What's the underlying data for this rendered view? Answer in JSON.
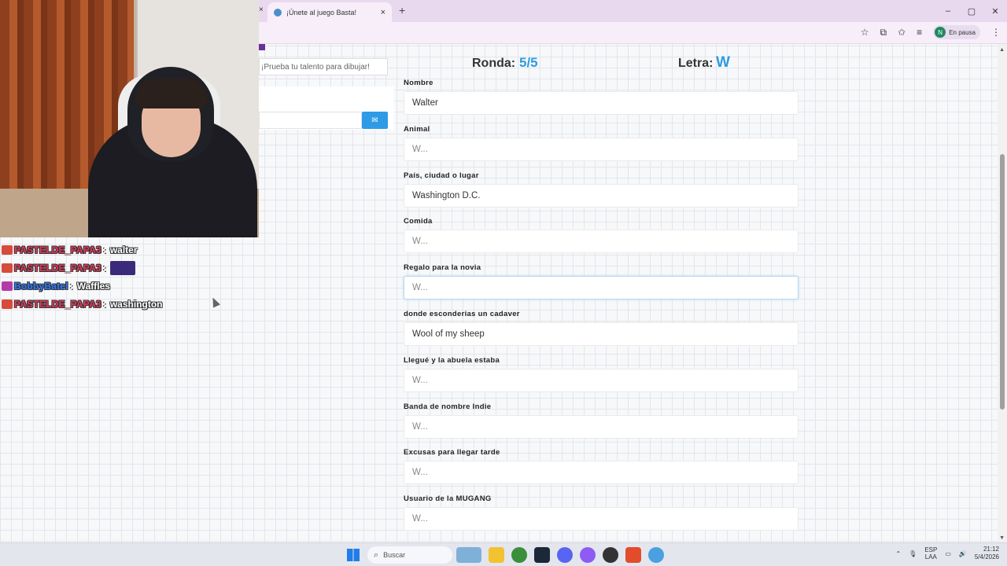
{
  "browser": {
    "tab_title": "¡Únete al juego Basta!",
    "tab_close": "×",
    "new_tab": "+",
    "window_controls": [
      "–",
      "▢",
      "✕"
    ],
    "profile_initial": "N",
    "profile_status": "En pausa"
  },
  "left_panel": {
    "draw_placeholder": "¡Prueba tu talento para dibujar!"
  },
  "stream_chat": [
    {
      "user": "PASTELDE_PAPA3",
      "message": "walter",
      "emote": false
    },
    {
      "user": "PASTELDE_PAPA3",
      "message": "",
      "emote": true
    },
    {
      "user": "BobbyBatel",
      "message": "Waffles",
      "emote": false
    },
    {
      "user": "PASTELDE_PAPA3",
      "message": "washington",
      "emote": false
    }
  ],
  "game": {
    "round_label": "Ronda:",
    "round_value": "5/5",
    "letter_label": "Letra:",
    "letter_value": "W",
    "fields": [
      {
        "label": "Nombre",
        "value": "Walter",
        "placeholder": "W..."
      },
      {
        "label": "Animal",
        "value": "",
        "placeholder": "W..."
      },
      {
        "label": "País, ciudad o lugar",
        "value": "Washington D.C.",
        "placeholder": "W..."
      },
      {
        "label": "Comida",
        "value": "",
        "placeholder": "W..."
      },
      {
        "label": "Regalo para la novia",
        "value": "",
        "placeholder": "W..."
      },
      {
        "label": "donde esconderias un cadaver",
        "value": "Wool of my sheep",
        "placeholder": "W..."
      },
      {
        "label": "Llegué y la abuela estaba",
        "value": "",
        "placeholder": "W..."
      },
      {
        "label": "Banda de nombre Indie",
        "value": "",
        "placeholder": "W..."
      },
      {
        "label": "Excusas para llegar tarde",
        "value": "",
        "placeholder": "W..."
      },
      {
        "label": "Usuario de la MUGANG",
        "value": "",
        "placeholder": "W..."
      }
    ]
  },
  "taskbar": {
    "search_label": "Buscar",
    "lang_top": "ESP",
    "lang_bottom": "LAA",
    "time": "21:12",
    "date": "5/4/2026"
  },
  "colors": {
    "accent": "#2e9be0",
    "chat_user": "#e8375c",
    "chat_user_alt": "#2e7bff"
  }
}
